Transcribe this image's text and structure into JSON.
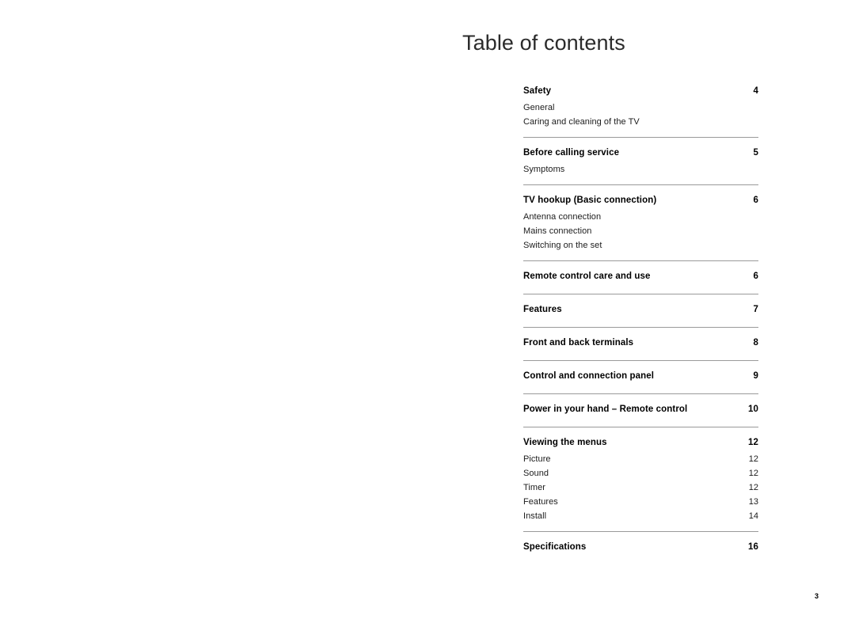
{
  "document": {
    "title": "Table of contents",
    "folio": "3"
  },
  "toc": {
    "sections": [
      {
        "heading": "Safety",
        "page": "4",
        "subentries": [
          {
            "label": "General",
            "page": ""
          },
          {
            "label": "Caring and cleaning of the TV",
            "page": ""
          }
        ]
      },
      {
        "heading": "Before calling service",
        "page": "5",
        "subentries": [
          {
            "label": "Symptoms",
            "page": ""
          }
        ]
      },
      {
        "heading": "TV hookup (Basic connection)",
        "page": "6",
        "subentries": [
          {
            "label": "Antenna connection",
            "page": ""
          },
          {
            "label": "Mains connection",
            "page": ""
          },
          {
            "label": "Switching on the set",
            "page": ""
          }
        ]
      },
      {
        "heading": "Remote control care and use",
        "page": "6",
        "subentries": []
      },
      {
        "heading": "Features",
        "page": "7",
        "subentries": []
      },
      {
        "heading": "Front and back terminals",
        "page": "8",
        "subentries": []
      },
      {
        "heading": "Control and connection panel",
        "page": "9",
        "subentries": []
      },
      {
        "heading": "Power in your hand – Remote control",
        "page": "10",
        "subentries": []
      },
      {
        "heading": "Viewing the menus",
        "page": "12",
        "subentries": [
          {
            "label": "Picture",
            "page": "12"
          },
          {
            "label": "Sound",
            "page": "12"
          },
          {
            "label": "Timer",
            "page": "12"
          },
          {
            "label": "Features",
            "page": "13"
          },
          {
            "label": "Install",
            "page": "14"
          }
        ]
      },
      {
        "heading": "Specifications",
        "page": "16",
        "subentries": []
      }
    ]
  }
}
